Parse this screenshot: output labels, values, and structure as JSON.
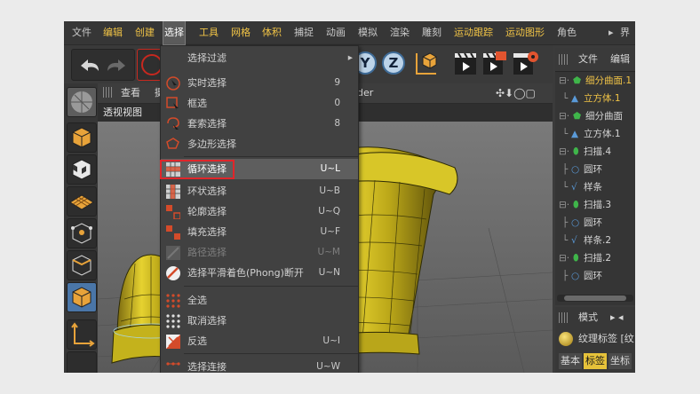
{
  "menubar": {
    "items": [
      "文件",
      "编辑",
      "创建",
      "选择",
      "工具",
      "网格",
      "体积",
      "捕捉",
      "动画",
      "模拟",
      "渲染",
      "雕刻",
      "运动跟踪",
      "运动图形",
      "角色",
      "界面"
    ],
    "highlighted": [
      1,
      2,
      3,
      4,
      5,
      6,
      12,
      13
    ],
    "active_index": 3
  },
  "toolbar": {
    "axis_y": "Y",
    "axis_z": "Z"
  },
  "viewport": {
    "header_items": [
      "查看",
      "摄"
    ],
    "header_right": "der",
    "view_name": "透视视图"
  },
  "select_menu": {
    "items": [
      {
        "label": "选择过滤",
        "shortcut": "",
        "submenu": true,
        "icon": "none"
      },
      {
        "label": "实时选择",
        "shortcut": "9",
        "icon": "live-select-icon"
      },
      {
        "label": "框选",
        "shortcut": "0",
        "icon": "rect-select-icon"
      },
      {
        "label": "套索选择",
        "shortcut": "8",
        "icon": "lasso-select-icon"
      },
      {
        "label": "多边形选择",
        "shortcut": "",
        "icon": "polygon-select-icon"
      },
      {
        "label": "循环选择",
        "shortcut": "U~L",
        "icon": "loop-select-icon",
        "highlighted": true
      },
      {
        "label": "环状选择",
        "shortcut": "U~B",
        "icon": "ring-select-icon"
      },
      {
        "label": "轮廓选择",
        "shortcut": "U~Q",
        "icon": "outline-select-icon"
      },
      {
        "label": "填充选择",
        "shortcut": "U~F",
        "icon": "fill-select-icon"
      },
      {
        "label": "路径选择",
        "shortcut": "U~M",
        "icon": "path-select-icon",
        "disabled": true
      },
      {
        "label": "选择平滑着色(Phong)断开",
        "shortcut": "U~N",
        "icon": "phong-break-icon"
      },
      {
        "label": "全选",
        "shortcut": "",
        "icon": "select-all-icon"
      },
      {
        "label": "取消选择",
        "shortcut": "",
        "icon": "deselect-icon"
      },
      {
        "label": "反选",
        "shortcut": "U~I",
        "icon": "invert-select-icon"
      },
      {
        "label": "选择连接",
        "shortcut": "U~W",
        "icon": "select-connected-icon"
      }
    ]
  },
  "object_manager": {
    "tabs": [
      "文件",
      "编辑"
    ],
    "tree": [
      {
        "label": "细分曲面.1",
        "indent": 0,
        "selected": true,
        "icon": "subdivision-icon"
      },
      {
        "label": "立方体.1",
        "indent": 1,
        "selected": true,
        "icon": "cube-icon"
      },
      {
        "label": "细分曲面",
        "indent": 0,
        "icon": "subdivision-icon"
      },
      {
        "label": "立方体.1",
        "indent": 1,
        "icon": "cube-icon"
      },
      {
        "label": "扫描.4",
        "indent": 0,
        "icon": "sweep-icon"
      },
      {
        "label": "圆环",
        "indent": 1,
        "icon": "circle-spline-icon"
      },
      {
        "label": "样条",
        "indent": 1,
        "icon": "spline-icon"
      },
      {
        "label": "扫描.3",
        "indent": 0,
        "icon": "sweep-icon"
      },
      {
        "label": "圆环",
        "indent": 1,
        "icon": "circle-spline-icon"
      },
      {
        "label": "样条.2",
        "indent": 1,
        "icon": "spline-icon"
      },
      {
        "label": "扫描.2",
        "indent": 0,
        "icon": "sweep-icon"
      },
      {
        "label": "圆环",
        "indent": 1,
        "icon": "circle-spline-icon"
      }
    ]
  },
  "attributes": {
    "mode_label": "模式",
    "tag_label": "纹理标签 [纹",
    "tabs": [
      "基本",
      "标签",
      "坐标"
    ]
  },
  "colors": {
    "accent_yellow": "#f0c346",
    "highlight_red": "#e0262a",
    "axis_blue": "#3f6c98"
  }
}
